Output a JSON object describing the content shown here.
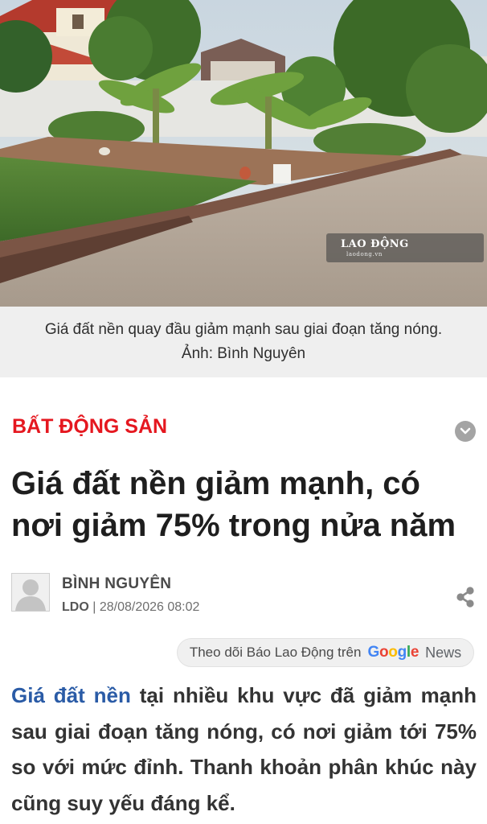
{
  "hero": {
    "watermark_brand": "LAO ĐỘNG",
    "watermark_url": "laodong.vn",
    "caption_line1": "Giá đất nền quay đầu giảm mạnh sau giai đoạn tăng nóng.",
    "caption_line2": "Ảnh: Bình Nguyên"
  },
  "article": {
    "category": "BẤT ĐỘNG SẢN",
    "headline": "Giá đất nền giảm mạnh, có nơi giảm 75% trong nửa năm",
    "author": "BÌNH NGUYÊN",
    "source": "LDO",
    "separator": " | ",
    "datetime": "28/08/2026 08:02",
    "lead_link": "Giá đất nền",
    "lead_rest": " tại nhiều khu vực đã giảm mạnh sau giai đoạn tăng nóng, có nơi giảm tới 75% so với mức đỉnh. Thanh khoản phân khúc này cũng suy yếu đáng kể."
  },
  "follow": {
    "text": "Theo dõi Báo Lao Động trên",
    "google_letters": [
      "G",
      "o",
      "o",
      "g",
      "l",
      "e"
    ],
    "google_colors": [
      "#4285F4",
      "#EA4335",
      "#FBBC05",
      "#4285F4",
      "#34A853",
      "#EA4335"
    ],
    "news_label": "News"
  },
  "icons": {
    "expand": "chevron-down-icon",
    "share": "share-icon",
    "avatar": "person-placeholder-icon"
  },
  "colors": {
    "category_red": "#e5171f",
    "link_blue": "#2a5ba6",
    "caption_bg": "#efefef"
  }
}
